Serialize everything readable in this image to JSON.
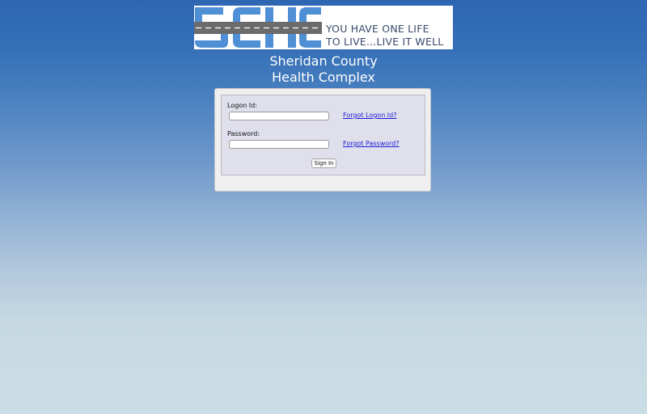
{
  "logo": {
    "letters": "SCHC",
    "tagline_line1": "YOU HAVE ONE LIFE",
    "tagline_line2": "TO LIVE...LIVE IT WELL",
    "letter_color": "#4f8fd6",
    "road_color": "#6b6b6b"
  },
  "org": {
    "name_line1": "Sheridan County",
    "name_line2": "Health Complex"
  },
  "login": {
    "logon_id_label": "Logon Id:",
    "logon_id_value": "",
    "forgot_logon_link": "Forgot Logon Id?",
    "password_label": "Password:",
    "password_value": "",
    "forgot_password_link": "Forgot Password?",
    "sign_in_button": "Sign In"
  },
  "colors": {
    "background_top": "#2e66b2",
    "background_bottom": "#cbdde5",
    "link": "#1a1ad6",
    "form_box": "#e0e0ec"
  }
}
